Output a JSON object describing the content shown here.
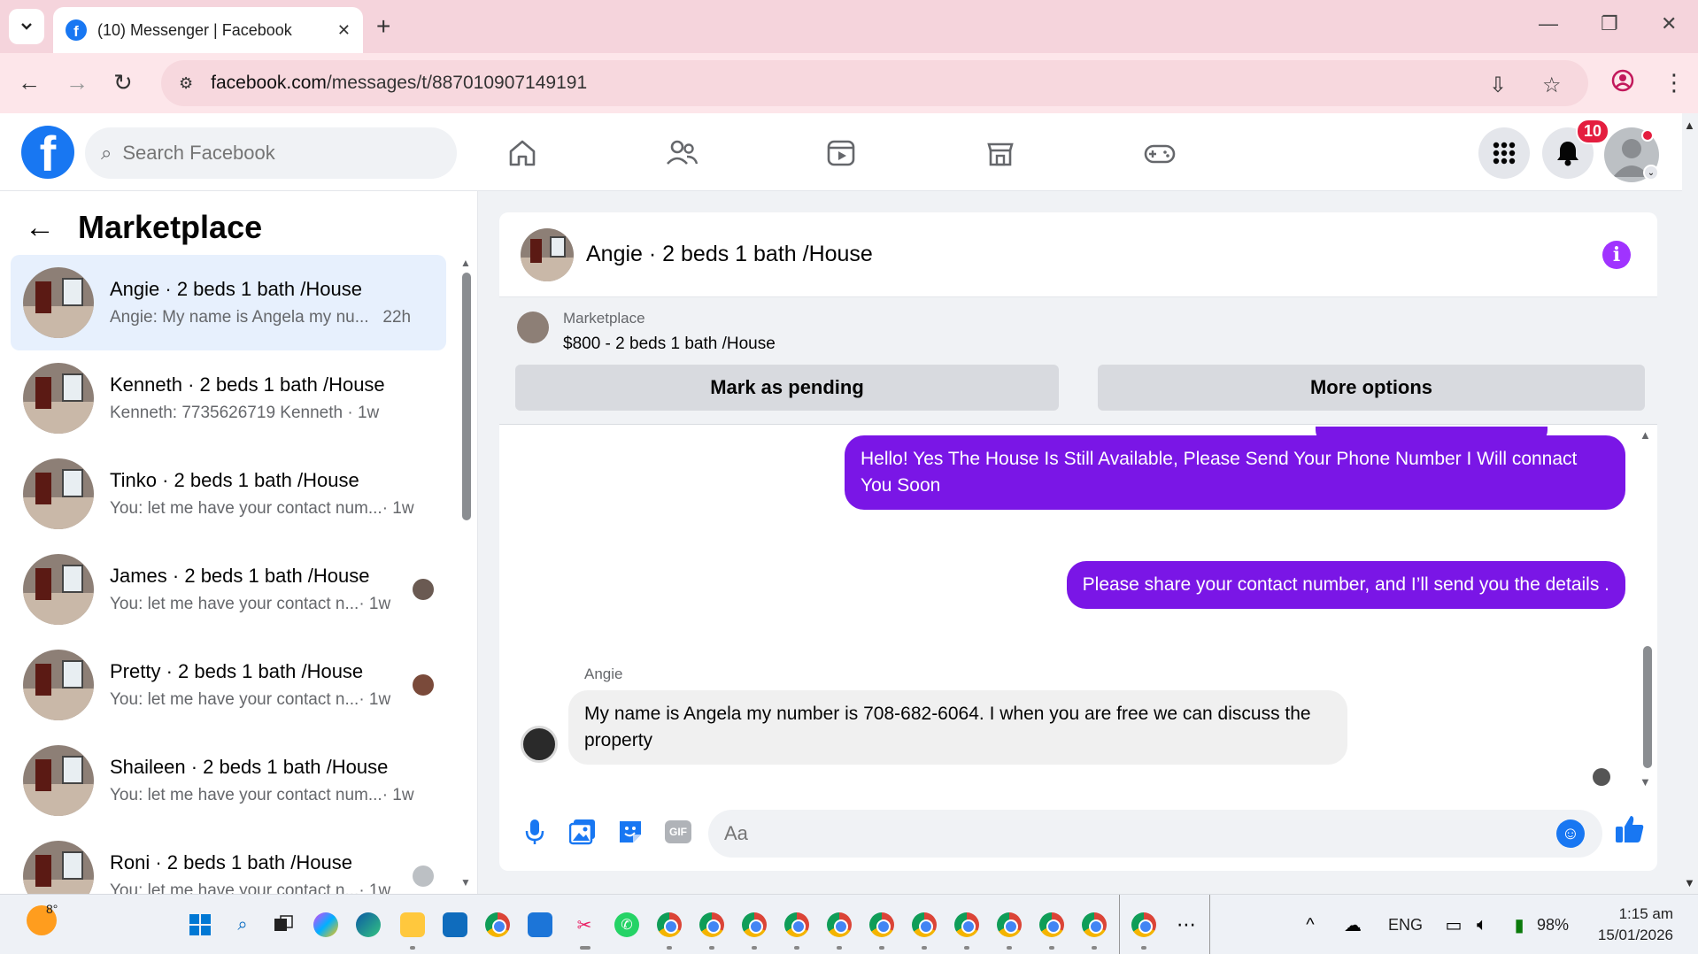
{
  "browser": {
    "tab_title": "(10) Messenger | Facebook",
    "url_host": "facebook.com",
    "url_path": "/messages/t/887010907149191"
  },
  "fb_header": {
    "search_placeholder": "Search Facebook",
    "notification_count": "10",
    "brand_color": "#1877f2"
  },
  "left_panel": {
    "title": "Marketplace",
    "conversations": [
      {
        "name": "Angie · 2 beds 1 bath /House",
        "snippet": "Angie: My name is Angela my nu...",
        "time": "22h",
        "active": true
      },
      {
        "name": "Kenneth · 2 beds 1 bath /House",
        "snippet": "Kenneth: 7735626719 Kenneth · 1w",
        "time": ""
      },
      {
        "name": "Tinko · 2 beds 1 bath /House",
        "snippet": "You: let me have your contact num...",
        "time": "· 1w"
      },
      {
        "name": "James · 2 beds 1 bath /House",
        "snippet": "You: let me have your contact n...",
        "time": "· 1w"
      },
      {
        "name": "Pretty · 2 beds 1 bath /House",
        "snippet": "You: let me have your contact n...",
        "time": "· 1w"
      },
      {
        "name": "Shaileen · 2 beds 1 bath /House",
        "snippet": "You: let me have your contact num...",
        "time": "· 1w"
      },
      {
        "name": "Roni · 2 beds 1 bath /House",
        "snippet": "You: let me have your contact n...",
        "time": "· 1w"
      }
    ]
  },
  "chat": {
    "title": "Angie · 2 beds 1 bath /House",
    "marketplace_label": "Marketplace",
    "listing": "$800 - 2 beds 1 bath /House",
    "mark_pending_label": "Mark as pending",
    "more_options_label": "More options",
    "messages": {
      "out1": "Hello! Yes The House  Is Still Available, Please Send Your Phone Number I Will connact You Soon",
      "out2": "Please share your contact number, and I’ll send you the details .",
      "in_sender": "Angie",
      "in1": "My name is Angela my number is 708-682-6064. I when you are free we can discuss the property"
    },
    "composer_placeholder": "Aa",
    "accent_color": "#7a16e6"
  },
  "taskbar": {
    "temperature": "8°",
    "language": "ENG",
    "battery": "98%",
    "time": "1:15 am",
    "date": "15/01/2026"
  }
}
